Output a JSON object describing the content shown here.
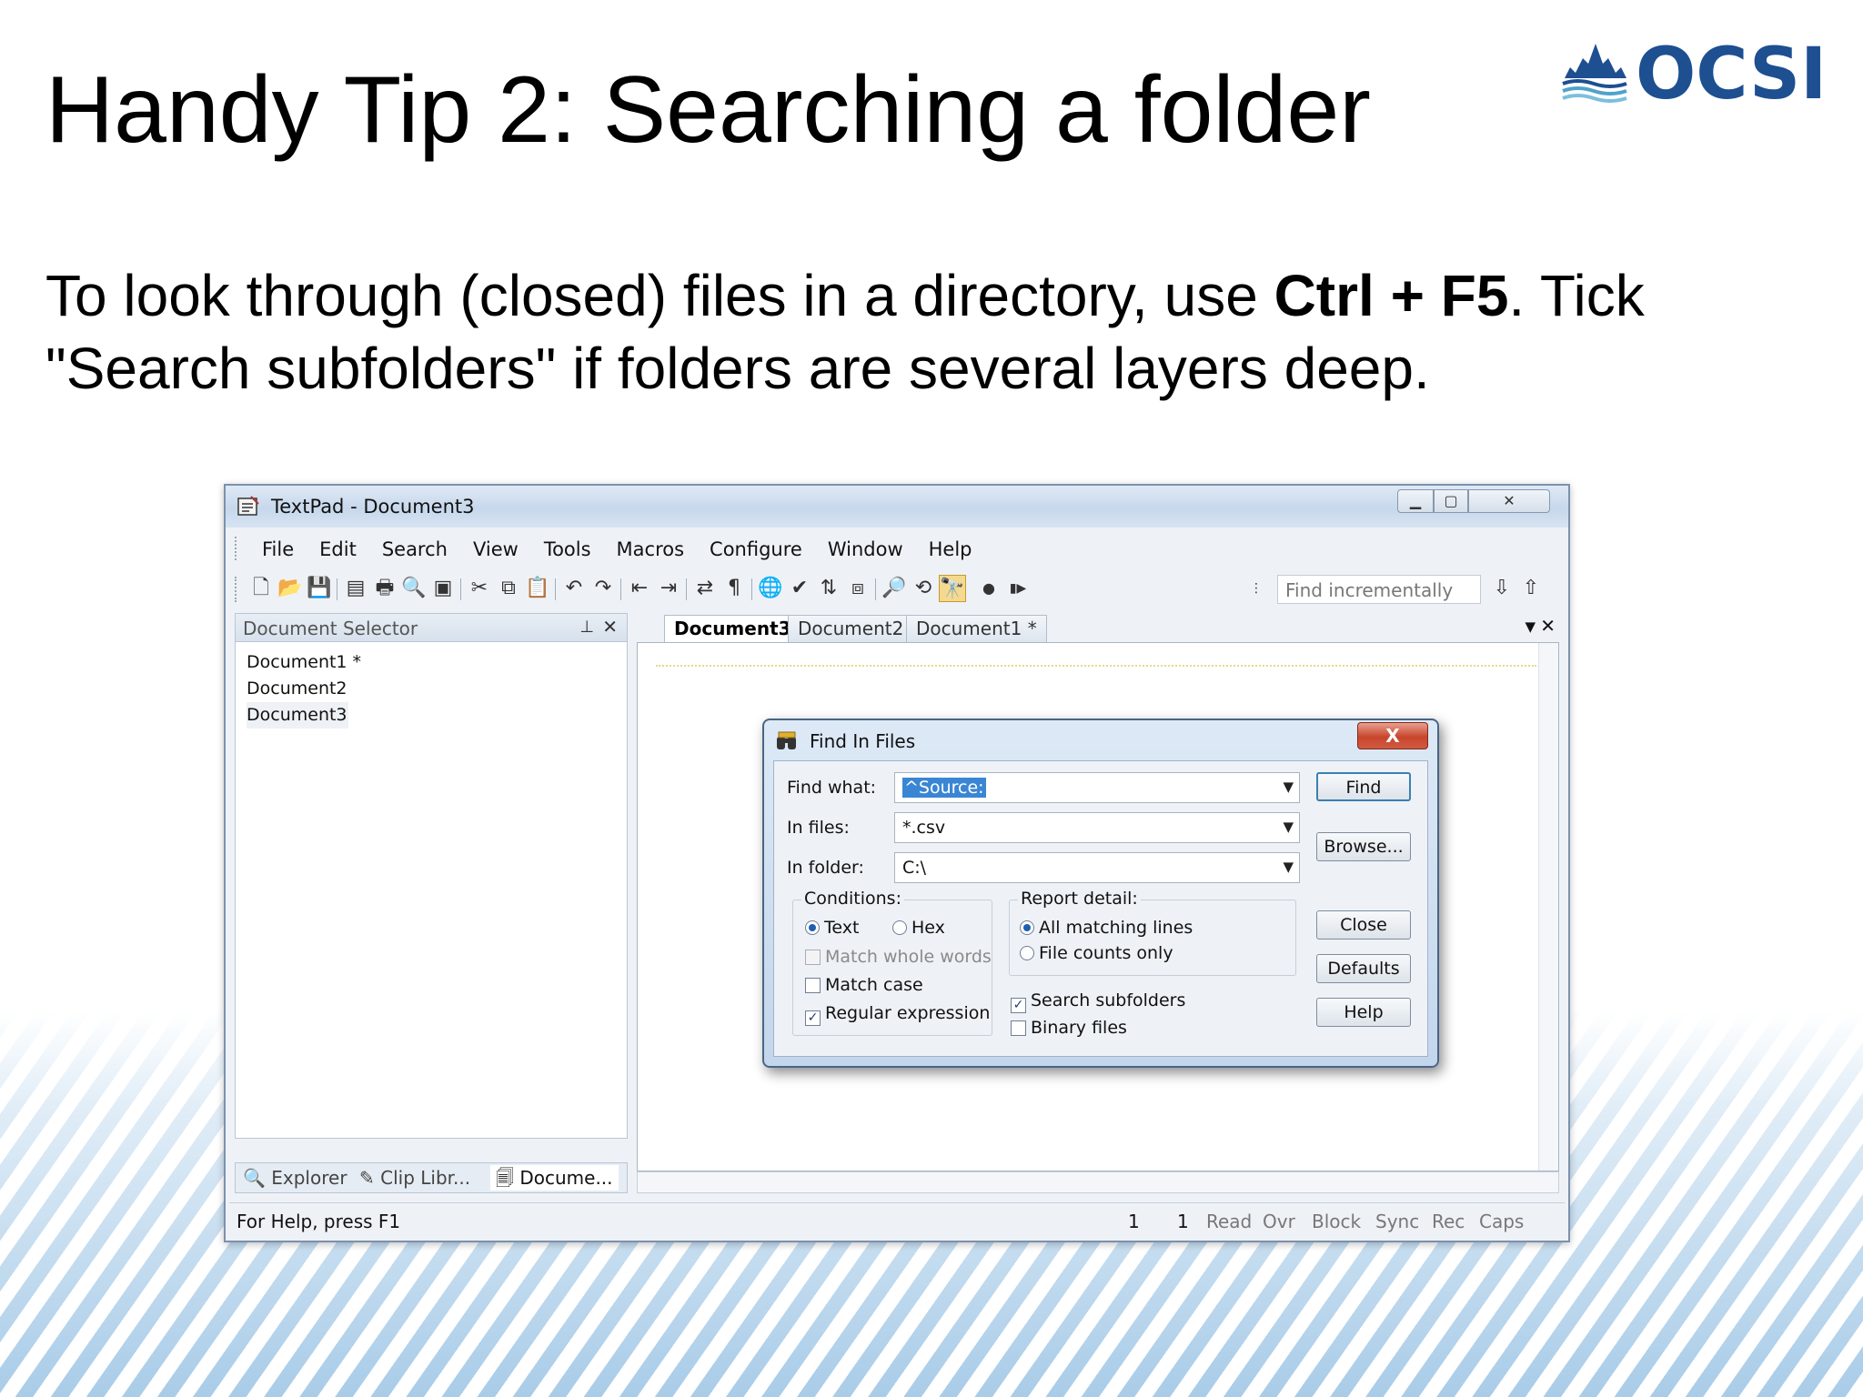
{
  "slide": {
    "title": "Handy Tip 2: Searching a folder",
    "body_part1": "To look through (closed) files in a directory, use ",
    "body_bold": "Ctrl + F5",
    "body_part2": ". Tick \"Search subfolders\" if folders are several layers deep.",
    "logo_text": "OCSI",
    "colors": {
      "logo_blue": "#1d4f91",
      "stripe_blue": "#a9cce8"
    }
  },
  "window": {
    "title": "TextPad - Document3",
    "menu": [
      "File",
      "Edit",
      "Search",
      "View",
      "Tools",
      "Macros",
      "Configure",
      "Window",
      "Help"
    ],
    "toolbar_icons": [
      "new-file-icon",
      "open-folder-icon",
      "save-icon",
      "save-all-icon",
      "print-icon",
      "print-preview-icon",
      "document-properties-icon",
      "cut-icon",
      "copy-icon",
      "paste-icon",
      "undo-icon",
      "redo-icon",
      "outdent-icon",
      "indent-icon",
      "word-wrap-icon",
      "pilcrow-icon",
      "globe-icon",
      "spell-check-icon",
      "sort-icon",
      "compare-icon",
      "find-icon",
      "replace-icon",
      "find-in-files-icon",
      "record-macro-icon",
      "play-macro-icon"
    ],
    "find_incrementally_placeholder": "Find incrementally",
    "document_selector": {
      "title": "Document Selector",
      "documents": [
        "Document1 *",
        "Document2",
        "Document3"
      ]
    },
    "bottom_tabs": [
      "Explorer",
      "Clip Libr...",
      "Docume..."
    ],
    "editor_tabs": [
      "Document3",
      "Document2",
      "Document1 *"
    ],
    "status": {
      "help": "For Help, press F1",
      "line": "1",
      "col": "1",
      "flags": [
        "Read",
        "Ovr",
        "Block",
        "Sync",
        "Rec",
        "Caps"
      ]
    }
  },
  "dialog": {
    "title": "Find In Files",
    "find_what_label": "Find what:",
    "find_what_value": "^Source:",
    "in_files_label": "In files:",
    "in_files_value": "*.csv",
    "in_folder_label": "In folder:",
    "in_folder_value": "C:\\",
    "conditions_label": "Conditions:",
    "text_label": "Text",
    "hex_label": "Hex",
    "match_whole_words_label": "Match whole words",
    "match_case_label": "Match case",
    "regular_expression_label": "Regular expression",
    "report_detail_label": "Report detail:",
    "all_matching_lines_label": "All matching lines",
    "file_counts_only_label": "File counts only",
    "search_subfolders_label": "Search subfolders",
    "binary_files_label": "Binary files",
    "buttons": {
      "find": "Find",
      "browse": "Browse...",
      "close": "Close",
      "defaults": "Defaults",
      "help": "Help"
    },
    "close_glyph": "X",
    "checked_glyph": "✓"
  }
}
